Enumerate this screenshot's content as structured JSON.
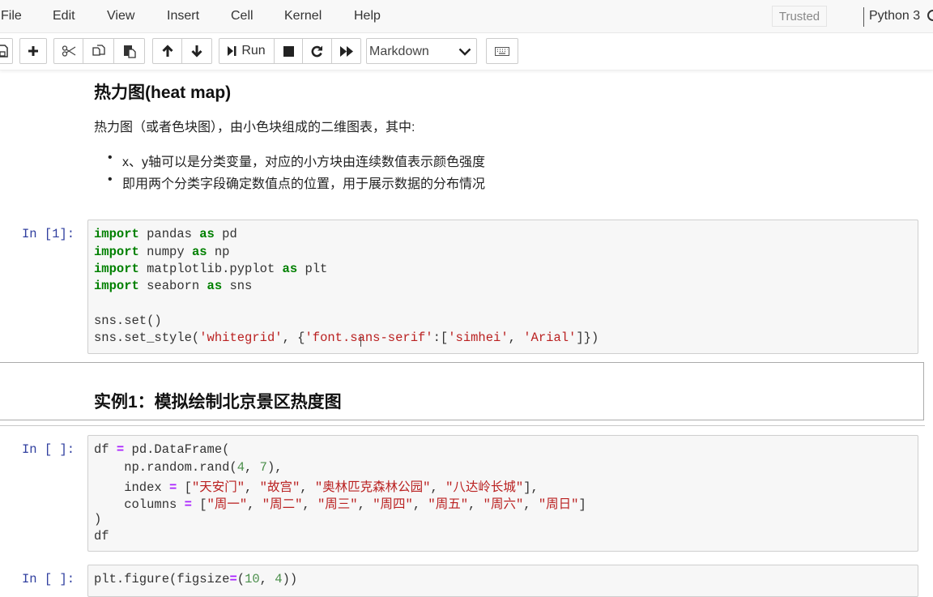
{
  "menubar": {
    "items": [
      "File",
      "Edit",
      "View",
      "Insert",
      "Cell",
      "Kernel",
      "Help"
    ],
    "trusted_label": "Trusted",
    "kernel_name": "Python 3"
  },
  "toolbar": {
    "icons": [
      "save-icon",
      "plus-icon",
      "scissors-icon",
      "copy-icon",
      "paste-icon",
      "arrow-up-icon",
      "arrow-down-icon",
      "step-run-icon",
      "stop-icon",
      "restart-icon",
      "fast-forward-icon",
      "keyboard-icon"
    ],
    "run_label": "Run",
    "cell_type_value": "Markdown"
  },
  "notebook": {
    "markdown_intro": {
      "heading": "热力图(heat map)",
      "paragraph": "热力图（或者色块图），由小色块组成的二维图表，其中:",
      "bullets": [
        "x、y轴可以是分类变量，对应的小方块由连续数值表示颜色强度",
        "即用两个分类字段确定数值点的位置，用于展示数据的分布情况"
      ]
    },
    "cell1": {
      "prompt": "In [1]:",
      "lines": [
        "import pandas as pd",
        "import numpy as np",
        "import matplotlib.pyplot as plt",
        "import seaborn as sns",
        "",
        "sns.set()",
        "sns.set_style('whitegrid', {'font.sans-serif':['simhei', 'Arial']})"
      ]
    },
    "markdown_example": {
      "heading": "实例1：模拟绘制北京景区热度图"
    },
    "cell2": {
      "prompt": "In [ ]:",
      "lines": [
        "df = pd.DataFrame(",
        "    np.random.rand(4, 7),",
        "    index = [\"天安门\", \"故宫\", \"奥林匹克森林公园\", \"八达岭长城\"],",
        "    columns = [\"周一\", \"周二\", \"周三\", \"周四\", \"周五\", \"周六\", \"周日\"]",
        ")",
        "df"
      ]
    },
    "cell3": {
      "prompt": "In [ ]:",
      "lines": [
        "plt.figure(figsize=(10, 4))"
      ]
    }
  }
}
